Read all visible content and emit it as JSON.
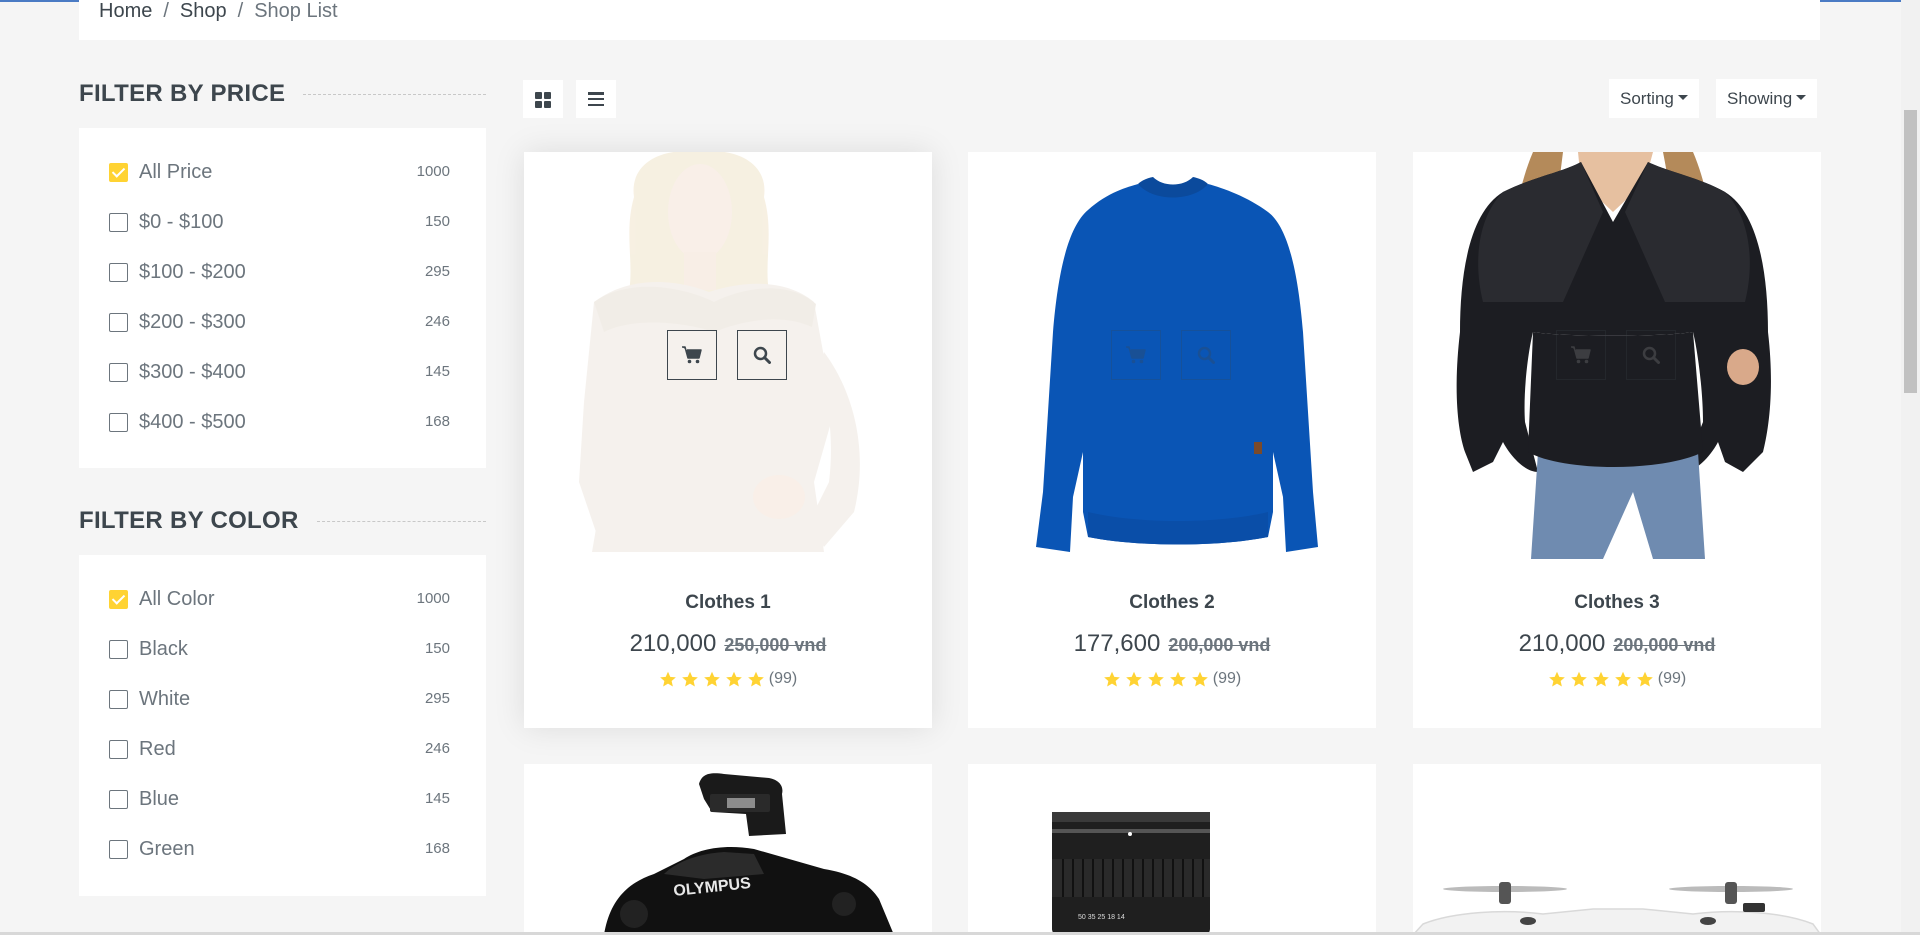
{
  "breadcrumb": [
    {
      "label": "Home"
    },
    {
      "label": "Shop"
    },
    {
      "label": "Shop List"
    }
  ],
  "filters": {
    "price": {
      "title": "Filter by price",
      "items": [
        {
          "label": "All Price",
          "count": "1000",
          "checked": true
        },
        {
          "label": "$0 - $100",
          "count": "150",
          "checked": false
        },
        {
          "label": "$100 - $200",
          "count": "295",
          "checked": false
        },
        {
          "label": "$200 - $300",
          "count": "246",
          "checked": false
        },
        {
          "label": "$300 - $400",
          "count": "145",
          "checked": false
        },
        {
          "label": "$400 - $500",
          "count": "168",
          "checked": false
        }
      ]
    },
    "color": {
      "title": "Filter by color",
      "items": [
        {
          "label": "All Color",
          "count": "1000",
          "checked": true
        },
        {
          "label": "Black",
          "count": "150",
          "checked": false
        },
        {
          "label": "White",
          "count": "295",
          "checked": false
        },
        {
          "label": "Red",
          "count": "246",
          "checked": false
        },
        {
          "label": "Blue",
          "count": "145",
          "checked": false
        },
        {
          "label": "Green",
          "count": "168",
          "checked": false
        }
      ]
    }
  },
  "toolbar": {
    "sorting_label": "Sorting",
    "showing_label": "Showing"
  },
  "products": [
    {
      "name": "Clothes 1",
      "price": "210,000",
      "old_price": "250,000 vnd",
      "rating_count": "(99)",
      "stars": 5
    },
    {
      "name": "Clothes 2",
      "price": "177,600",
      "old_price": "200,000 vnd",
      "rating_count": "(99)",
      "stars": 5
    },
    {
      "name": "Clothes 3",
      "price": "210,000",
      "old_price": "200,000 vnd",
      "rating_count": "(99)",
      "stars": 5
    }
  ],
  "colors": {
    "accent": "#ffd333",
    "text": "#3d464d",
    "muted": "#6c757d",
    "sweater_blue": "#0a55b5"
  }
}
